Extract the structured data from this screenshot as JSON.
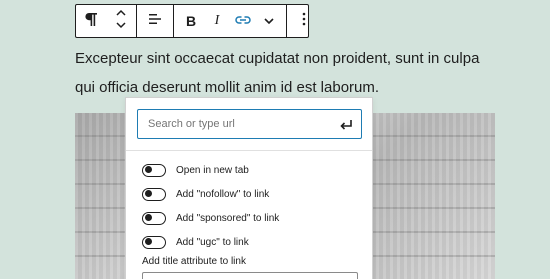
{
  "toolbar": {
    "paragraph_icon": "paragraph-icon",
    "move_icon": "chevron-up-down-icon",
    "align_icon": "align-left-icon",
    "bold_label": "B",
    "italic_label": "I",
    "link_icon": "link-icon",
    "more_rich_text_icon": "chevron-down-icon",
    "options_icon": "vertical-ellipsis-icon",
    "link_active_color": "#1e7cb3"
  },
  "paragraph": {
    "text": "Excepteur sint occaecat cupidatat non proident, sunt in culpa qui officia deserunt mollit anim id est laborum."
  },
  "link_popover": {
    "url": {
      "value": "",
      "placeholder": "Search or type url",
      "submit_icon": "enter-icon"
    },
    "settings": [
      {
        "label": "Open in new tab",
        "checked": false
      },
      {
        "label": "Add \"nofollow\" to link",
        "checked": false
      },
      {
        "label": "Add \"sponsored\" to link",
        "checked": false
      },
      {
        "label": "Add \"ugc\" to link",
        "checked": false
      }
    ],
    "title_attribute": {
      "label": "Add title attribute to link",
      "value": ""
    }
  },
  "colors": {
    "background": "#d3e3dc",
    "accent": "#1e7cb3",
    "text": "#1e1e1e"
  }
}
